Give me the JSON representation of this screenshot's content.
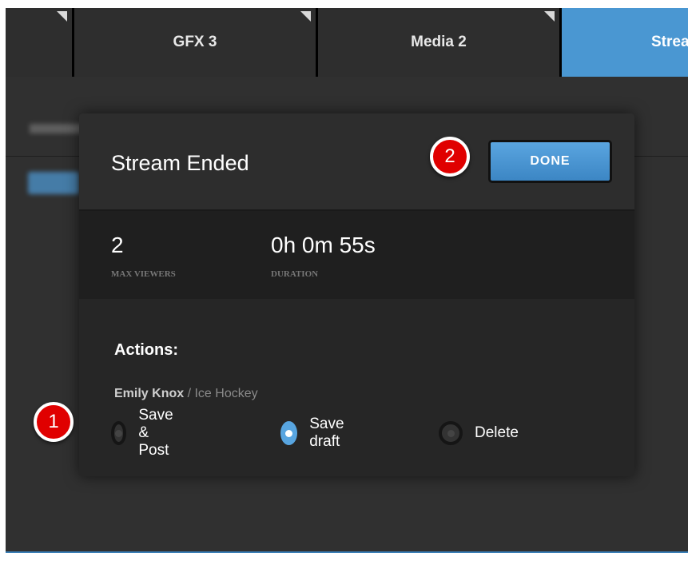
{
  "tabs": [
    {
      "label": ""
    },
    {
      "label": "GFX 3"
    },
    {
      "label": "Media 2"
    },
    {
      "label": "Strea"
    }
  ],
  "dialog": {
    "title": "Stream Ended",
    "done_label": "DONE",
    "stats": {
      "viewers_value": "2",
      "viewers_label": "MAX VIEWERS",
      "duration_value": "0h 0m 55s",
      "duration_label": "DURATION"
    },
    "actions_title": "Actions:",
    "stream_owner": "Emily Knox",
    "stream_separator": " / ",
    "stream_title": "Ice Hockey",
    "options": [
      {
        "label": "Save & Post",
        "selected": false
      },
      {
        "label": "Save draft",
        "selected": true
      },
      {
        "label": "Delete",
        "selected": false
      }
    ]
  },
  "markers": {
    "one": "1",
    "two": "2"
  },
  "colors": {
    "accent": "#4a97d2",
    "marker": "#e00000",
    "dialog_bg": "#262626"
  }
}
